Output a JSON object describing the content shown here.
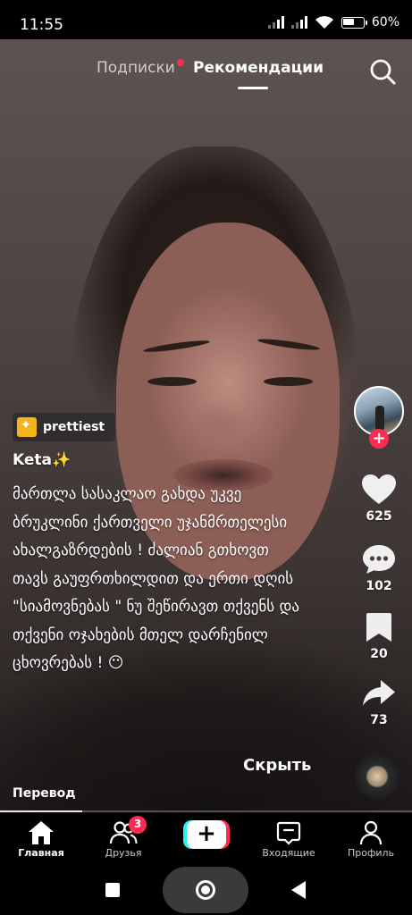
{
  "status_bar": {
    "time": "11:55",
    "battery_text": "60%",
    "battery_level": 0.6
  },
  "top_tabs": {
    "following_label": "Подписки",
    "for_you_label": "Рекомендации",
    "active": "for_you",
    "following_has_new": true,
    "search_icon": "search-icon"
  },
  "video": {
    "sticker_label": "prettiest",
    "author": "Keta✨",
    "caption": "მართლა სასაკლაო გახდა უკვე ბრუკლინი ქართველი უჯანმრთელესი ახალგაზრდების ! ძალიან გთხოვთ თავს გაუფრთხილდით და ერთი დღის \"სიამოვნებას \" ნუ შეწირავთ თქვენს და თქვენი ოჯახების მთელ დარჩენილ ცხოვრებას ! 😶",
    "hide_label": "Скрыть",
    "translate_label": "Перевод",
    "progress": 0.2
  },
  "actions": {
    "like_count": "625",
    "comment_count": "102",
    "bookmark_count": "20",
    "share_count": "73"
  },
  "bottom_nav": {
    "home": "Главная",
    "friends": "Друзья",
    "friends_badge": "3",
    "create": "+",
    "inbox": "Входящие",
    "profile": "Профиль",
    "active": "home"
  },
  "colors": {
    "accent": "#fe2c55",
    "create_cyan": "#25f4ee",
    "sticker": "#f4b51c"
  }
}
